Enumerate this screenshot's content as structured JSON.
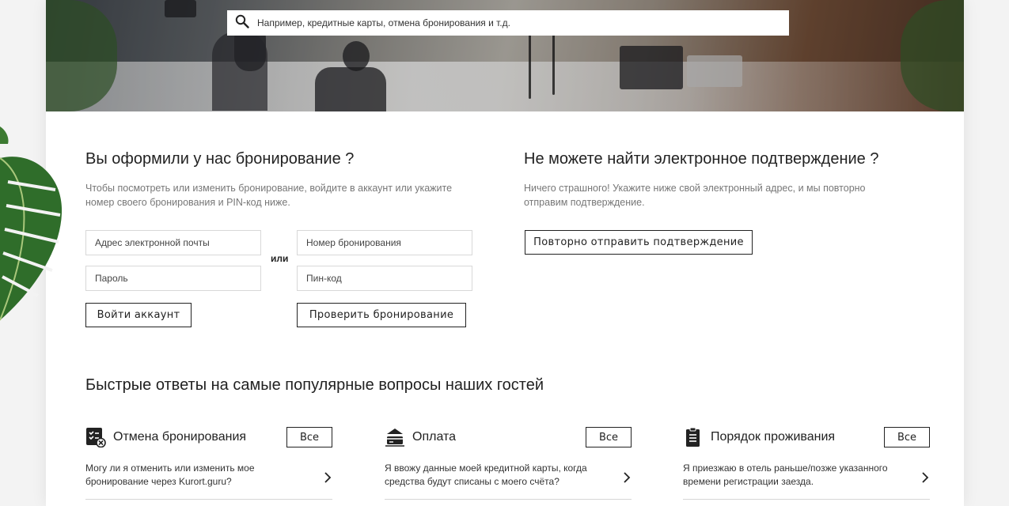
{
  "search": {
    "placeholder": "Например, кредитные карты, отмена бронирования и т.д.",
    "icon": "search-icon"
  },
  "booking": {
    "title": "Вы оформили у нас бронирование ?",
    "description": "Чтобы посмотреть или изменить бронирование, войдите в аккаунт или укажите номер своего бронирования и PIN-код ниже.",
    "email_placeholder": "Адрес электронной почты",
    "password_placeholder": "Пароль",
    "or_label": "или",
    "booking_number_placeholder": "Номер бронирования",
    "pin_placeholder": "Пин-код",
    "login_button": "Войти аккаунт",
    "check_button": "Проверить бронирование"
  },
  "confirmation": {
    "title": "Не можете найти электронное подтверждение ?",
    "description": "Ничего страшного! Укажите ниже свой электронный адрес, и мы повторно отправим подтверждение.",
    "resend_button": "Повторно отправить подтверждение"
  },
  "faq": {
    "title": "Быстрые ответы на самые популярные вопросы наших гостей",
    "cards": [
      {
        "icon": "cancel-booking-icon",
        "title": "Отмена бронирования",
        "all_label": "Все",
        "question": "Могу ли я отменить или изменить мое бронирование через Kurort.guru?"
      },
      {
        "icon": "payment-card-icon",
        "title": "Оплата",
        "all_label": "Все",
        "question": "Я ввожу данные моей кредитной карты, когда средства будут списаны с моего счёта?"
      },
      {
        "icon": "clipboard-icon",
        "title": "Порядок проживания",
        "all_label": "Все",
        "question": "Я приезжаю в отель раньше/позже указанного времени регистрации заезда."
      }
    ]
  },
  "colors": {
    "text": "#222222",
    "muted": "#777777",
    "border": "#d8d8d8",
    "page_bg": "#f3f3f3"
  }
}
